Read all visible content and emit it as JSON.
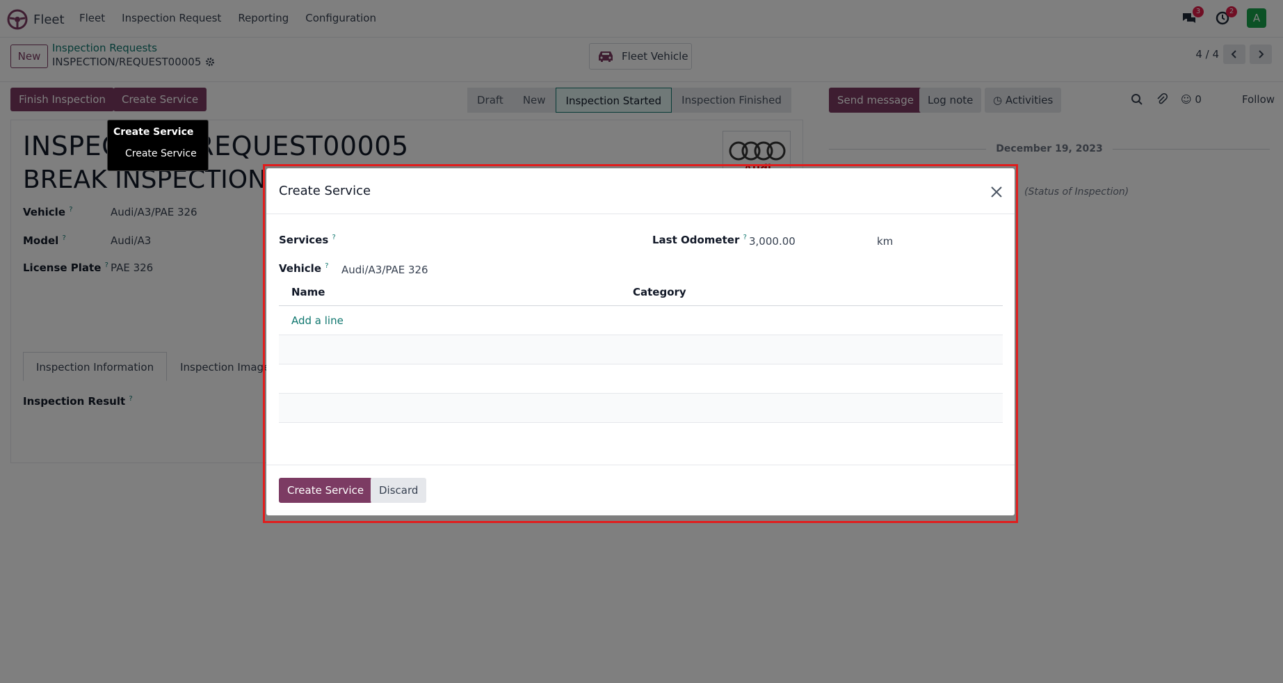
{
  "navbar": {
    "app_name": "Fleet",
    "menu": [
      "Fleet",
      "Inspection Request",
      "Reporting",
      "Configuration"
    ],
    "messages_badge": "3",
    "activities_badge": "2",
    "avatar_letter": "A",
    "avatar_color": "#16a34a"
  },
  "control": {
    "new_label": "New",
    "breadcrumb_parent": "Inspection Requests",
    "breadcrumb_current": "INSPECTION/REQUEST00005",
    "smart_button_label": "Fleet Vehicle",
    "pager": "4 / 4"
  },
  "actions": {
    "finish_label": "Finish Inspection",
    "create_service_label": "Create Service"
  },
  "statusbar": {
    "stages": [
      "Draft",
      "New",
      "Inspection Started",
      "Inspection Finished"
    ],
    "active": "Inspection Started"
  },
  "chatter": {
    "send_message": "Send message",
    "log_note": "Log note",
    "activities": "Activities",
    "followers_count": "0",
    "follow": "Follow",
    "date": "December 19, 2023",
    "status_text": "(Status of Inspection)"
  },
  "form": {
    "title_line1": "INSPECTION/REQUEST00005",
    "title_line2": "BREAK INSPECTION",
    "fields": [
      {
        "label": "Vehicle",
        "value": "Audi/A3/PAE 326"
      },
      {
        "label": "Model",
        "value": "Audi/A3"
      },
      {
        "label": "License Plate",
        "value": "PAE 326"
      }
    ],
    "tabs": [
      "Inspection Information",
      "Inspection Images"
    ],
    "result_label": "Inspection Result",
    "logo_text": "Audi"
  },
  "tooltip": {
    "heading": "Create Service",
    "item": "Create Service"
  },
  "modal": {
    "title": "Create Service",
    "services_label": "Services",
    "vehicle_label": "Vehicle",
    "vehicle_value": "Audi/A3/PAE 326",
    "odometer_label": "Last Odometer",
    "odometer_value": "3,000.00",
    "odometer_unit": "km",
    "columns": [
      "Name",
      "Category"
    ],
    "add_line": "Add a line",
    "create_button": "Create Service",
    "discard_button": "Discard"
  },
  "colors": {
    "primary": "#7c3b63",
    "link": "#0f766e",
    "highlight": "#e11d1d"
  }
}
